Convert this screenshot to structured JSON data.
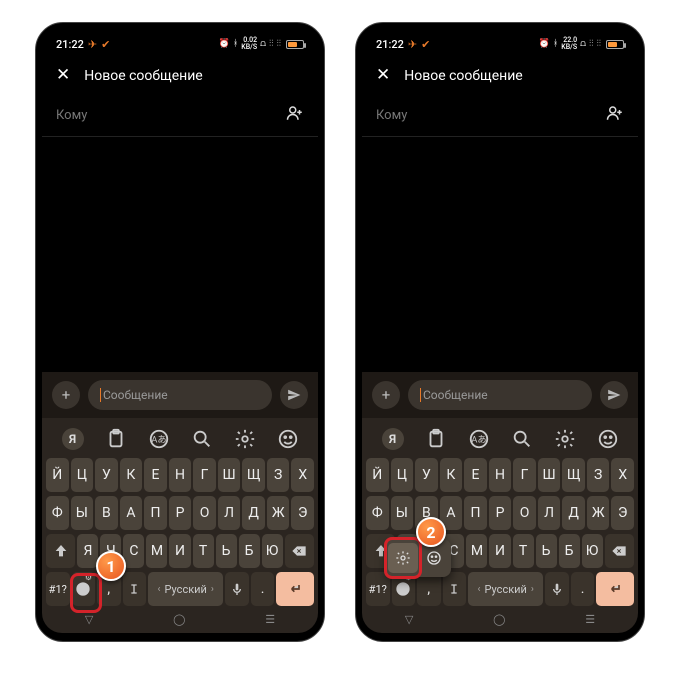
{
  "status": {
    "time": "21:22",
    "speed1": "0.02",
    "speed2": "22.0",
    "unit": "KB/S"
  },
  "header": {
    "title": "Новое сообщение"
  },
  "recipient": {
    "label": "Кому"
  },
  "compose": {
    "placeholder": "Сообщение"
  },
  "keyboard": {
    "row1": [
      "Й",
      "Ц",
      "У",
      "К",
      "Е",
      "Н",
      "Г",
      "Ш",
      "Щ",
      "З",
      "Х"
    ],
    "row2": [
      "Ф",
      "Ы",
      "В",
      "А",
      "П",
      "Р",
      "О",
      "Л",
      "Д",
      "Ж",
      "Э"
    ],
    "row3": [
      "Я",
      "Ч",
      "С",
      "М",
      "И",
      "Т",
      "Ь",
      "Б",
      "Ю"
    ],
    "symKey": "#1?",
    "spaceLabel": "Русский"
  },
  "badges": {
    "left": "1",
    "right": "2"
  }
}
